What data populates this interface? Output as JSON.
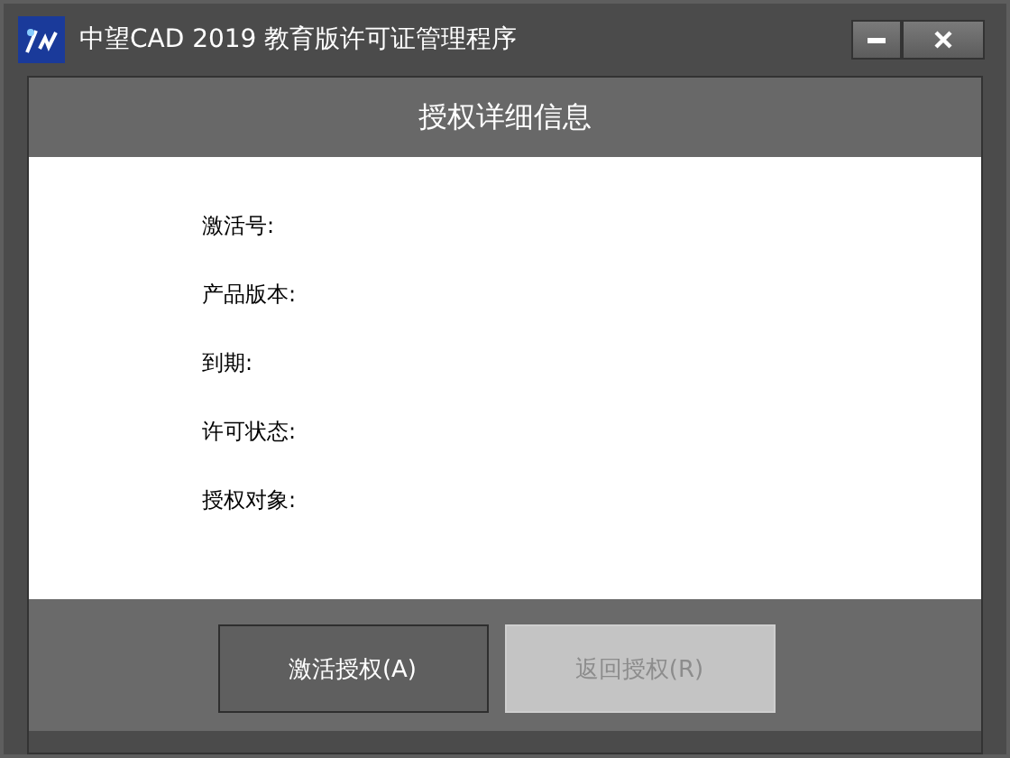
{
  "window": {
    "title": "中望CAD 2019 教育版许可证管理程序"
  },
  "header": "授权详细信息",
  "fields": [
    {
      "label": "激活号:"
    },
    {
      "label": "产品版本:"
    },
    {
      "label": "到期:"
    },
    {
      "label": "许可状态:"
    },
    {
      "label": "授权对象:"
    }
  ],
  "buttons": [
    {
      "label": "激活授权(A)",
      "disabled": false
    },
    {
      "label": "返回授权(R)",
      "disabled": true
    }
  ]
}
